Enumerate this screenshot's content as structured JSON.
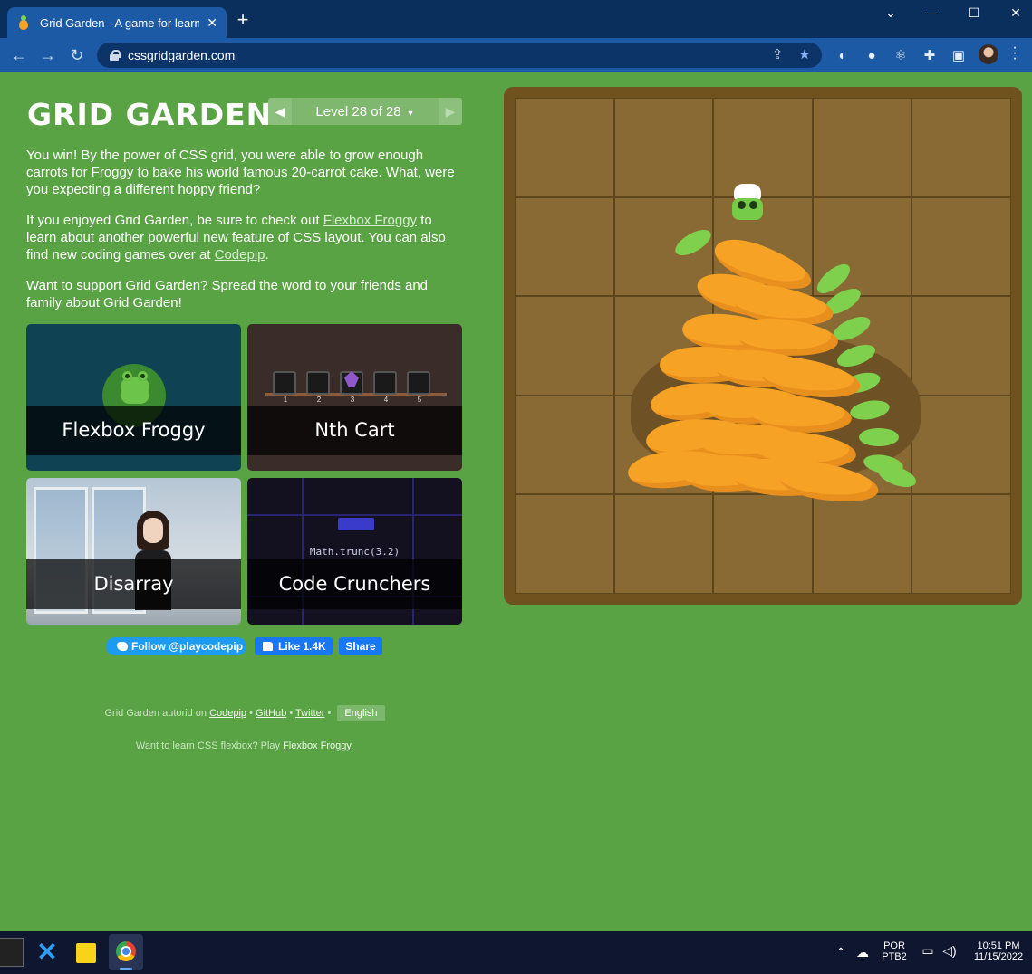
{
  "browser": {
    "tab_title": "Grid Garden - A game for learnin",
    "tab_close": "✕",
    "new_tab": "+",
    "url": "cssgridgarden.com",
    "window_controls": [
      "⌄",
      "—",
      "☐",
      "✕"
    ]
  },
  "page": {
    "logo": "GRID GARDEN",
    "level_label": "Level 28 of 28",
    "level_caret": "▼",
    "prev_arrow": "◀",
    "next_arrow": "▶",
    "win_text": "You win! By the power of CSS grid, you were able to grow enough carrots for Froggy to bake his world famous 20-carrot cake. What, were you expecting a different hoppy friend?",
    "enjoy_text_1": "If you enjoyed Grid Garden, be sure to check out ",
    "enjoy_link_1": "Flexbox Froggy",
    "enjoy_text_2": " to learn about another powerful new feature of CSS layout. You can also find new coding games over at ",
    "enjoy_link_2": "Codepip",
    "enjoy_text_3": ".",
    "support_text": "Want to support Grid Garden? Spread the word to your friends and family about Grid Garden!",
    "games": [
      {
        "title": "Flexbox Froggy"
      },
      {
        "title": "Nth Cart"
      },
      {
        "title": "Disarray"
      },
      {
        "title": "Code Crunchers"
      }
    ],
    "cart_numbers": [
      "1",
      "2",
      "3",
      "4",
      "5"
    ],
    "code_text": "Math.trunc(3.2)",
    "social": {
      "twitter": "Follow @playcodepip",
      "like": "Like 1.4K",
      "share": "Share"
    },
    "footer": {
      "autor_text": "Grid Garden autorid on ",
      "codepip": "Codepip",
      "github": "GitHub",
      "twitter": "Twitter",
      "sep": " • ",
      "language": "English",
      "flexbox_text": "Want to learn CSS flexbox? Play ",
      "flexbox_link": "Flexbox Froggy",
      "flexbox_end": "."
    }
  },
  "taskbar": {
    "lang_1": "POR",
    "lang_2": "PTB2",
    "time": "10:51 PM",
    "date": "11/15/2022"
  },
  "colors": {
    "page_bg": "#5aa345",
    "board_frame": "#70521f",
    "soil": "#8a6a34",
    "carrot": "#f5a225",
    "leaf": "#7fd04c",
    "tab_blue": "#1c5aa6"
  }
}
